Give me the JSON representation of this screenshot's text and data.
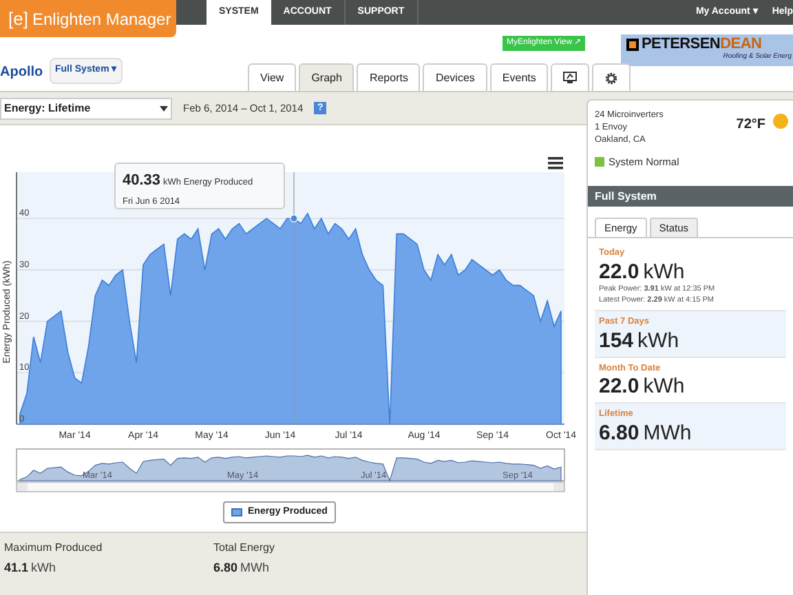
{
  "logo": {
    "mark": "[e]",
    "name": "Enlighten Manager"
  },
  "top_nav": [
    {
      "label": "SYSTEM",
      "selected": true
    },
    {
      "label": "ACCOUNT",
      "selected": false
    },
    {
      "label": "SUPPORT",
      "selected": false
    }
  ],
  "account_menu": {
    "label": "My Account ▾",
    "help": "Help"
  },
  "myenlighten_button": "MyEnlighten View ↗",
  "partner_logo": {
    "name_part_1": "PETERSEN",
    "name_part_2": "DEAN",
    "tagline": "Roofing & Solar Energ"
  },
  "system": {
    "name": "Apollo",
    "selector": "Full System ▾"
  },
  "tabs": [
    {
      "label": "View",
      "kind": "text",
      "selected": false
    },
    {
      "label": "Graph",
      "kind": "text",
      "selected": true
    },
    {
      "label": "Reports",
      "kind": "text",
      "selected": false
    },
    {
      "label": "Devices",
      "kind": "text",
      "selected": false
    },
    {
      "label": "Events",
      "kind": "text",
      "selected": false
    },
    {
      "kind": "monitor",
      "selected": false
    },
    {
      "kind": "gear",
      "selected": false
    }
  ],
  "toolbar": {
    "dropdown": "Energy: Lifetime",
    "date_range": "Feb 6, 2014 – Oct 1, 2014",
    "help": "?"
  },
  "chart": {
    "tooltip": {
      "value": "40.33",
      "unit": "kWh Energy Produced",
      "date": "Fri Jun 6 2014"
    },
    "chart_data": {
      "type": "area",
      "grid": true,
      "ylabel": "Energy Produced (kWh)",
      "ylim": [
        0,
        49
      ],
      "yticks": [
        0,
        10,
        20,
        30,
        40
      ],
      "categories": [
        null,
        null,
        null,
        null,
        null,
        null,
        null,
        null,
        "Mar '14",
        null,
        null,
        null,
        null,
        null,
        null,
        null,
        null,
        null,
        "Apr '14",
        null,
        null,
        null,
        null,
        null,
        null,
        null,
        null,
        null,
        "May '14",
        null,
        null,
        null,
        null,
        null,
        null,
        null,
        null,
        null,
        "Jun '14",
        null,
        null,
        null,
        null,
        null,
        null,
        null,
        null,
        null,
        "Jul '14",
        null,
        null,
        null,
        null,
        null,
        null,
        null,
        null,
        null,
        null,
        "Aug '14",
        null,
        null,
        null,
        null,
        null,
        null,
        null,
        null,
        null,
        "Sep '14",
        null,
        null,
        null,
        null,
        null,
        null,
        null,
        null,
        null,
        "Oct '14"
      ],
      "series": [
        {
          "name": "Energy Produced",
          "color": "#6fa3ea",
          "values": [
            2,
            6,
            17,
            12,
            20,
            21,
            22,
            14,
            9,
            8,
            15,
            25,
            28,
            27,
            29,
            30,
            20,
            12,
            31,
            33,
            34,
            35,
            25,
            36,
            37,
            36,
            38,
            30,
            37,
            38,
            36,
            38,
            39,
            37,
            38,
            39,
            40,
            39,
            38,
            40,
            40,
            39,
            41,
            38,
            40,
            37,
            39,
            38,
            36,
            38,
            33,
            30,
            28,
            27,
            0,
            37,
            37,
            36,
            35,
            30,
            28,
            33,
            31,
            33,
            29,
            30,
            32,
            31,
            30,
            29,
            30,
            28,
            27,
            27,
            26,
            25,
            20,
            24,
            19,
            22
          ]
        }
      ]
    }
  },
  "navigator": {
    "labels": [
      "Mar '14",
      "May '14",
      "Jul '14",
      "Sep '14"
    ]
  },
  "stats": [
    {
      "label": "Maximum Produced",
      "value": "41.1",
      "unit": "kWh"
    },
    {
      "label": "Total Energy",
      "value": "6.80",
      "unit": "MWh"
    }
  ],
  "site": {
    "lines": [
      "24 Microinverters",
      "1 Envoy",
      "Oakland, CA"
    ],
    "temperature": "72°F",
    "status": "System Normal",
    "status_ok": true
  },
  "panel_title": "Full System",
  "panel_tabs": [
    {
      "label": "Energy",
      "selected": true
    },
    {
      "label": "Status",
      "selected": false
    }
  ],
  "energy": [
    {
      "label": "Today",
      "value": "22.0",
      "unit": "kWh",
      "details": [
        "Peak Power: **3.91** kW at 12:35 PM",
        "Latest Power: **2.29** kW at 4:15 PM"
      ],
      "shaded": false
    },
    {
      "label": "Past 7 Days",
      "value": "154",
      "unit": "kWh",
      "shaded": true
    },
    {
      "label": "Month To Date",
      "value": "22.0",
      "unit": "kWh",
      "shaded": false
    },
    {
      "label": "Lifetime",
      "value": "6.80",
      "unit": "MWh",
      "shaded": true
    }
  ]
}
